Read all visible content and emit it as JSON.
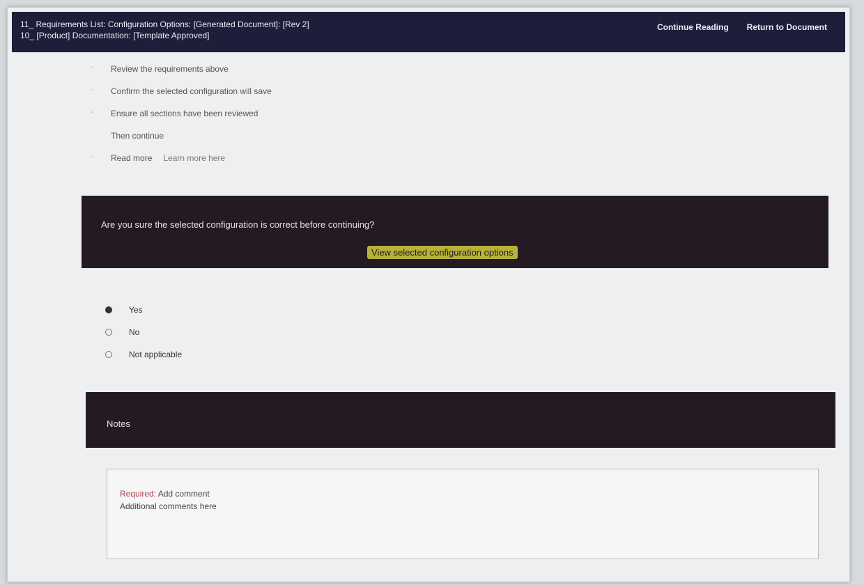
{
  "header": {
    "title_line1": "11_ Requirements List: Configuration Options: [Generated Document]: [Rev 2]",
    "title_line2": "10_ [Product] Documentation: [Template Approved]",
    "links": [
      "Continue Reading",
      "Return to Document"
    ]
  },
  "checklist": {
    "items": [
      {
        "label": "Review the requirements above"
      },
      {
        "label": "Confirm the selected configuration will save"
      },
      {
        "label": "Ensure all sections have been reviewed"
      },
      {
        "label": "Then continue"
      },
      {
        "label": "Read more",
        "extra": "Learn more here"
      }
    ]
  },
  "panel1": {
    "text": "Are you sure the selected configuration is correct before continuing?",
    "link": "View selected configuration options"
  },
  "radios": {
    "options": [
      {
        "label": "Yes",
        "checked": true
      },
      {
        "label": "No",
        "checked": false
      },
      {
        "label": "Not applicable",
        "checked": false
      }
    ]
  },
  "panel2": {
    "text": "Notes"
  },
  "notes": {
    "line1_red": "Required:",
    "line1_rest": " Add comment",
    "line2": "Additional comments here"
  }
}
